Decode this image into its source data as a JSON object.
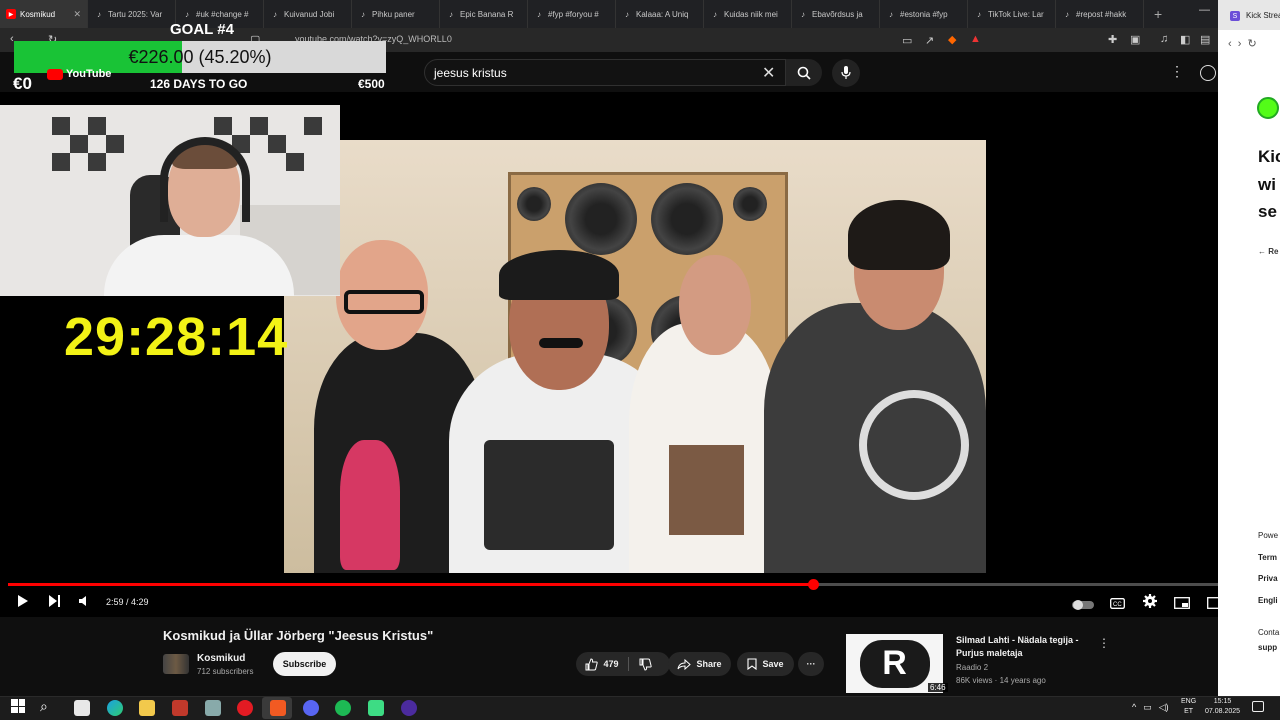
{
  "browser": {
    "tabs": [
      {
        "label": "Kosmikud",
        "icon": "youtube-icon",
        "active": true
      },
      {
        "label": "Tartu 2025: Var",
        "icon": "tiktok-icon"
      },
      {
        "label": "#uk #change #",
        "icon": "tiktok-icon"
      },
      {
        "label": "Kuivanud Jobi",
        "icon": "tiktok-icon"
      },
      {
        "label": "Pihku paner",
        "icon": "tiktok-icon"
      },
      {
        "label": "Epic Banana R",
        "icon": "tiktok-icon"
      },
      {
        "label": "#fyp #foryou #",
        "icon": "tiktok-icon"
      },
      {
        "label": "Kalaaa: A Uniq",
        "icon": "tiktok-icon"
      },
      {
        "label": "Kuidas niik mei",
        "icon": "tiktok-icon"
      },
      {
        "label": "Ebavõrdsus ja",
        "icon": "tiktok-icon"
      },
      {
        "label": "#estonia #fyp",
        "icon": "tiktok-icon"
      },
      {
        "label": "TikTok Live: Lar",
        "icon": "tiktok-icon"
      },
      {
        "label": "#repost #hakk",
        "icon": "tiktok-icon"
      }
    ],
    "new_tab": "+",
    "url": "youtube.com/watch?v=zyQ_WHORLL0"
  },
  "youtube": {
    "search_value": "jeesus kristus",
    "search_clear": "✕"
  },
  "overlay": {
    "goal_title": "GOAL #4",
    "goal_amount": "€226.00 (45.20%)",
    "goal_progress": 0.452,
    "goal_min": "€0",
    "goal_days": "126 DAYS TO GO",
    "goal_max": "€500",
    "yt_logo": "YouTube",
    "countdown": "29:28:14"
  },
  "player": {
    "time": "2:59 / 4:29",
    "progress": 0.6654,
    "accent": "#ff0000"
  },
  "video": {
    "title": "Kosmikud ja Üllar Jörberg \"Jeesus Kristus\"",
    "channel": "Kosmikud",
    "subscribers": "712 subscribers",
    "subscribe_label": "Subscribe",
    "likes": "479",
    "share_label": "Share",
    "save_label": "Save"
  },
  "recommendation": {
    "title": "Silmad Lahti - Nädala tegija - Purjus maletaja",
    "channel": "Raadio 2",
    "meta": "86K views · 14 years ago",
    "duration": "6:46",
    "logo_letter": "R"
  },
  "sidepanel": {
    "tab_label": "Kick Strea",
    "heading_lines": [
      "Kic",
      "wi",
      "se"
    ],
    "back_link": "← Re",
    "footer": [
      "Powe",
      "Term",
      "Priva",
      "Engli",
      "Conta",
      "supp"
    ]
  },
  "taskbar": {
    "lang_top": "ENG",
    "lang_bottom": "ET",
    "time": "15:15",
    "date": "07.08.2025"
  }
}
